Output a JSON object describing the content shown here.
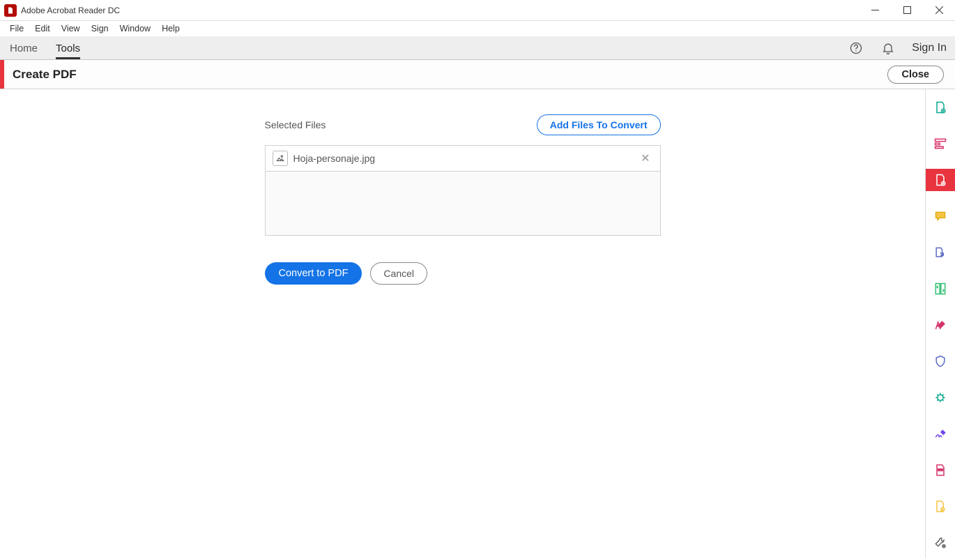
{
  "app": {
    "title": "Adobe Acrobat Reader DC"
  },
  "menu": {
    "items": [
      "File",
      "Edit",
      "View",
      "Sign",
      "Window",
      "Help"
    ]
  },
  "tabs": {
    "home": "Home",
    "tools": "Tools"
  },
  "header": {
    "signin": "Sign In"
  },
  "tool": {
    "title": "Create PDF",
    "close": "Close"
  },
  "panel": {
    "selected_label": "Selected Files",
    "add_label": "Add Files To Convert",
    "files": [
      {
        "name": "Hoja-personaje.jpg"
      }
    ],
    "convert": "Convert to PDF",
    "cancel": "Cancel"
  },
  "rail": {
    "items": [
      "export-pdf",
      "edit-pdf",
      "create-pdf",
      "comment",
      "combine-files",
      "organize-pages",
      "fill-sign",
      "protect",
      "stamp",
      "sign",
      "redact",
      "compare",
      "more-tools"
    ],
    "active_index": 2
  }
}
